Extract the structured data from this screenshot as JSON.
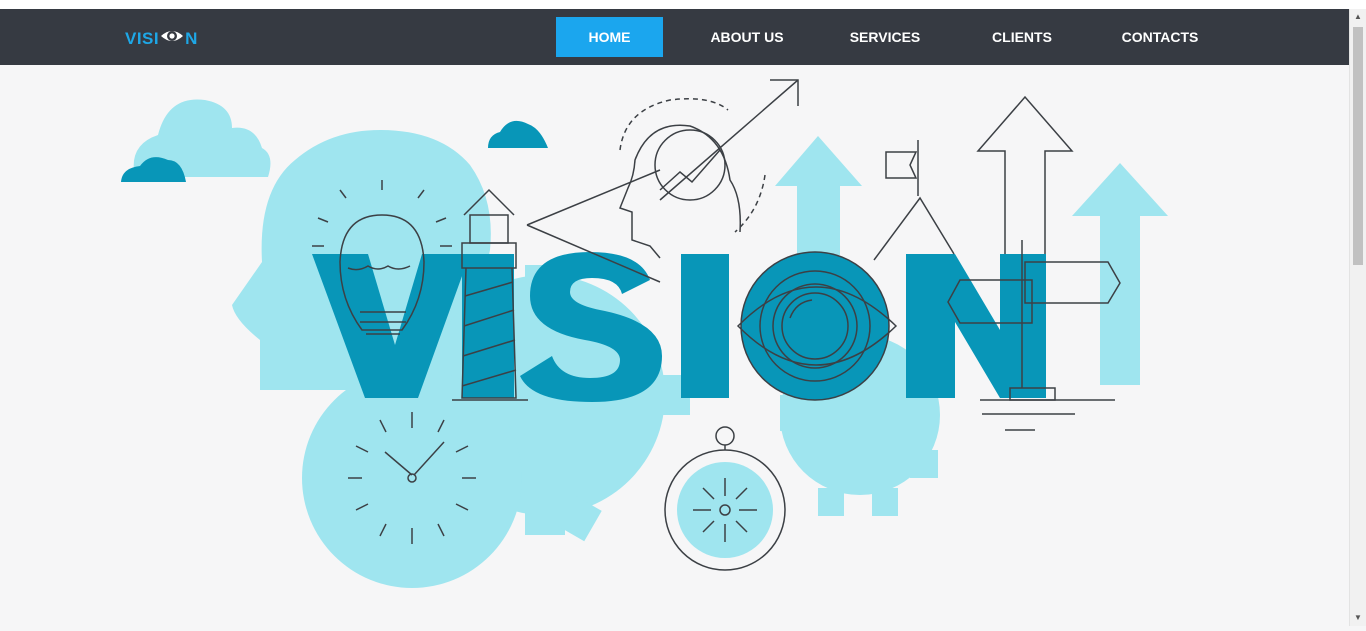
{
  "logo": {
    "prefix": "VISI",
    "suffix": "N",
    "icon": "eye-icon"
  },
  "nav": [
    {
      "label": "HOME",
      "active": true
    },
    {
      "label": "ABOUT US",
      "active": false
    },
    {
      "label": "SERVICES",
      "active": false
    },
    {
      "label": "CLIENTS",
      "active": false
    },
    {
      "label": "CONTACTS",
      "active": false
    }
  ],
  "hero": {
    "word": "VISION",
    "illustration": "vision-concept-illustration"
  },
  "colors": {
    "navbar": "#363a42",
    "accent": "#1ba6ee",
    "illustration_light": "#9fe5ef",
    "illustration_dark": "#0896b8",
    "line": "#3c4045"
  },
  "scrollbar": {
    "up_arrow": "▲",
    "down_arrow": "▼"
  }
}
